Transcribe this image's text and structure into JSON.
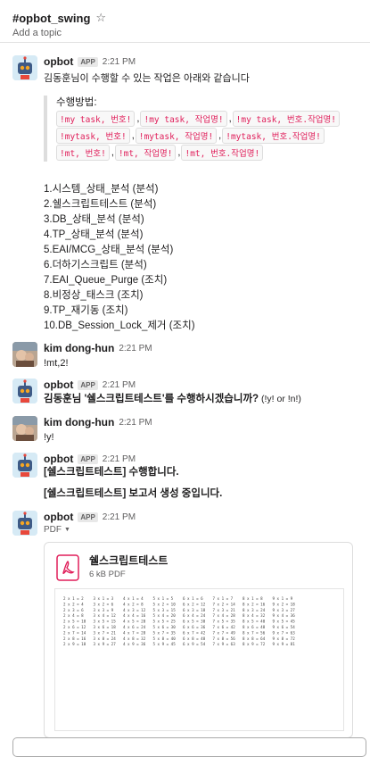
{
  "channel": {
    "name": "#opbot_swing",
    "add_topic": "Add a topic"
  },
  "messages": {
    "m1": {
      "sender": "opbot",
      "badge": "APP",
      "time": "2:21 PM",
      "intro": "김동훈님이 수행할 수 있는 작업은 아래와 같습니다",
      "method_label": "수행방법:",
      "code_rows": [
        [
          "!my task, 번호!",
          "!my task, 작업명!",
          "!my task, 번호.작업명!"
        ],
        [
          "!mytask, 번호!",
          "!mytask, 작업명!",
          "!mytask, 번호.작업명!"
        ],
        [
          "!mt, 번호!",
          "!mt, 작업명!",
          "!mt, 번호.작업명!"
        ]
      ],
      "tasks": [
        "1.시스템_상태_분석 (분석)",
        "2.쉘스크립트테스트 (분석)",
        "3.DB_상태_분석 (분석)",
        "4.TP_상태_분석 (분석)",
        "5.EAI/MCG_상태_분석 (분석)",
        "6.더하기스크립트 (분석)",
        "7.EAI_Queue_Purge (조치)",
        "8.비정상_태스크 (조치)",
        "9.TP_재기동 (조치)",
        "10.DB_Session_Lock_제거 (조치)"
      ]
    },
    "m2": {
      "sender": "kim dong-hun",
      "time": "2:21 PM",
      "text": "!mt,2!"
    },
    "m3": {
      "sender": "opbot",
      "badge": "APP",
      "time": "2:21 PM",
      "text_bold": "김동훈님 '쉘스크립트테스트'를 수행하시겠습니까?",
      "text_rest": " (!y! or !n!)"
    },
    "m4": {
      "sender": "kim dong-hun",
      "time": "2:21 PM",
      "text": "!y!"
    },
    "m5": {
      "sender": "opbot",
      "badge": "APP",
      "time": "2:21 PM",
      "line1": "[쉘스크립트테스트] 수행합니다.",
      "line2": "[쉘스크립트테스트] 보고서 생성 중입니다."
    },
    "m6": {
      "sender": "opbot",
      "badge": "APP",
      "time": "2:21 PM",
      "file_type": "PDF",
      "file_name": "쉘스크립트테스트",
      "file_size": "6 kB PDF",
      "preview_rows": [
        [
          "2 x 1 = 2",
          "3 x 1 = 3",
          "4 x 1 = 4",
          "5 x 1 = 5",
          "6 x 1 = 6",
          "7 x 1 = 7",
          "8 x 1 = 8",
          "9 x 1 = 9"
        ],
        [
          "2 x 2 = 4",
          "3 x 2 = 6",
          "4 x 2 = 8",
          "5 x 2 = 10",
          "6 x 2 = 12",
          "7 x 2 = 14",
          "8 x 2 = 16",
          "9 x 2 = 18"
        ],
        [
          "2 x 3 = 6",
          "3 x 3 = 9",
          "4 x 3 = 12",
          "5 x 3 = 15",
          "6 x 3 = 18",
          "7 x 3 = 21",
          "8 x 3 = 24",
          "9 x 3 = 27"
        ],
        [
          "2 x 4 = 8",
          "3 x 4 = 12",
          "4 x 4 = 16",
          "5 x 4 = 20",
          "6 x 4 = 24",
          "7 x 4 = 28",
          "8 x 4 = 32",
          "9 x 4 = 36"
        ],
        [
          "2 x 5 = 10",
          "3 x 5 = 15",
          "4 x 5 = 20",
          "5 x 5 = 25",
          "6 x 5 = 30",
          "7 x 5 = 35",
          "8 x 5 = 40",
          "9 x 5 = 45"
        ],
        [
          "2 x 6 = 12",
          "3 x 6 = 18",
          "4 x 6 = 24",
          "5 x 6 = 30",
          "6 x 6 = 36",
          "7 x 6 = 42",
          "8 x 6 = 48",
          "9 x 6 = 54"
        ],
        [
          "2 x 7 = 14",
          "3 x 7 = 21",
          "4 x 7 = 28",
          "5 x 7 = 35",
          "6 x 7 = 42",
          "7 x 7 = 49",
          "8 x 7 = 56",
          "9 x 7 = 63"
        ],
        [
          "2 x 8 = 16",
          "3 x 8 = 24",
          "4 x 8 = 32",
          "5 x 8 = 40",
          "6 x 8 = 48",
          "7 x 8 = 56",
          "8 x 8 = 64",
          "9 x 8 = 72"
        ],
        [
          "2 x 9 = 18",
          "3 x 9 = 27",
          "4 x 9 = 36",
          "5 x 9 = 45",
          "6 x 9 = 54",
          "7 x 9 = 63",
          "8 x 9 = 72",
          "9 x 9 = 81"
        ]
      ]
    }
  }
}
